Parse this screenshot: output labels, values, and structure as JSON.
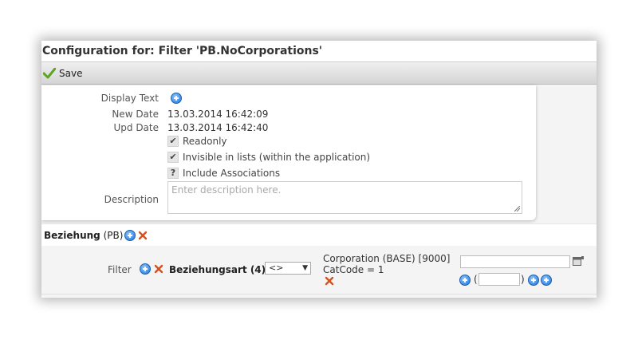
{
  "window": {
    "title": "Configuration for: Filter 'PB.NoCorporations'"
  },
  "toolbar": {
    "save_label": "Save"
  },
  "form": {
    "display_text_label": "Display Text",
    "new_date_label": "New Date",
    "new_date_value": "13.03.2014 16:42:09",
    "upd_date_label": "Upd Date",
    "upd_date_value": "13.03.2014 16:42:40",
    "readonly_label": "Readonly",
    "readonly_checked": true,
    "invisible_label": "Invisible in lists (within the application)",
    "invisible_checked": true,
    "include_assoc_label": "Include Associations",
    "include_assoc_state": "?",
    "description_label": "Description",
    "description_placeholder": "Enter description here."
  },
  "relation": {
    "name": "Beziehung",
    "suffix": "(PB)"
  },
  "filter": {
    "label": "Filter",
    "field_name": "Beziehungsart (4)",
    "operator": "<>",
    "value_line1": "Corporation (BASE) [9000]",
    "value_line2": "CatCode = 1",
    "paren_open": "(",
    "paren_close": ")"
  },
  "icons": {
    "add": "plus-circle-icon",
    "remove": "x-icon",
    "save": "checkmark-icon",
    "picker": "calendar-picker-icon"
  },
  "colors": {
    "add_blue": "#1f74d6",
    "remove_red": "#d4501c",
    "save_green": "#5ca51f"
  }
}
